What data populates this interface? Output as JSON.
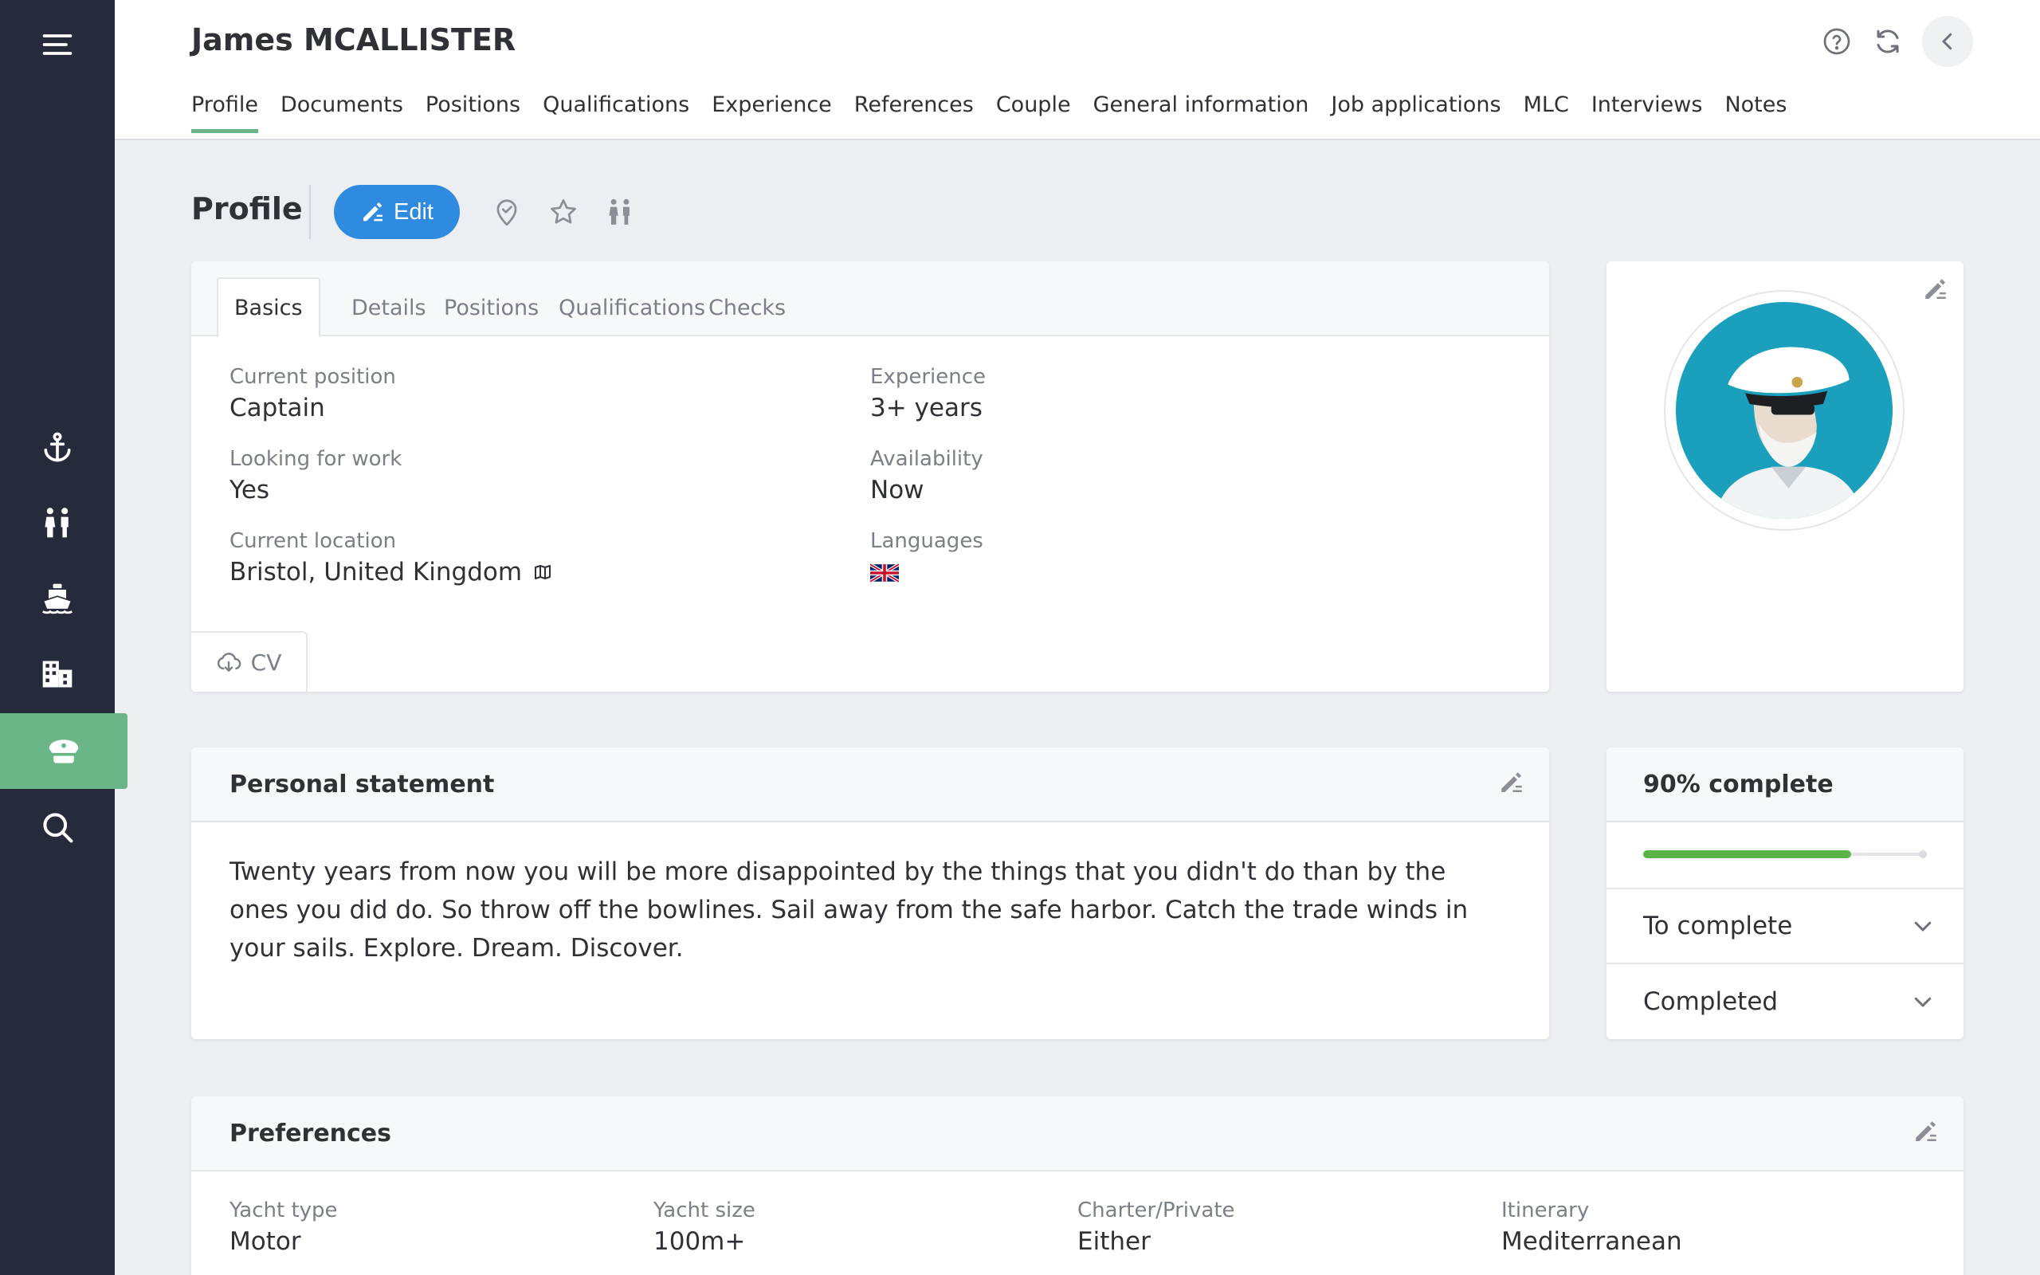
{
  "header": {
    "candidate_name": "James MCALLISTER",
    "tabs": [
      "Profile",
      "Documents",
      "Positions",
      "Qualifications",
      "Experience",
      "References",
      "Couple",
      "General information",
      "Job applications",
      "MLC",
      "Interviews",
      "Notes"
    ],
    "active_tab": "Profile"
  },
  "sidebar": {
    "items": [
      "menu-icon",
      "anchor-icon",
      "couple-icon",
      "ship-icon",
      "building-icon",
      "captain-hat-icon",
      "search-icon"
    ],
    "active": "captain-hat-icon"
  },
  "section": {
    "title": "Profile",
    "edit_label": "Edit"
  },
  "basics": {
    "tabs": [
      "Basics",
      "Details",
      "Positions",
      "Qualifications",
      "Checks"
    ],
    "active_tab": "Basics",
    "current_position_label": "Current position",
    "current_position": "Captain",
    "experience_label": "Experience",
    "experience": "3+ years",
    "looking_label": "Looking for work",
    "looking": "Yes",
    "availability_label": "Availability",
    "availability": "Now",
    "location_label": "Current location",
    "location": "Bristol, United Kingdom",
    "languages_label": "Languages",
    "languages": [
      "uk-flag-icon"
    ],
    "cv_label": "CV"
  },
  "statement": {
    "title": "Personal statement",
    "text": "Twenty years from now you will be more disappointed by the things that you didn't do than by the ones you did do. So throw off the bowlines. Sail away from the safe harbor. Catch the trade winds in your sails. Explore. Dream. Discover."
  },
  "completion": {
    "title": "90% complete",
    "percent": 90,
    "to_complete_label": "To complete",
    "completed_label": "Completed"
  },
  "preferences": {
    "title": "Preferences",
    "yacht_type_label": "Yacht type",
    "yacht_type": "Motor",
    "yacht_size_label": "Yacht size",
    "yacht_size": "100m+",
    "charter_label": "Charter/Private",
    "charter": "Either",
    "itinerary_label": "Itinerary",
    "itinerary": "Mediterranean"
  },
  "colors": {
    "sidebar": "#262b3b",
    "accent_green": "#6bb687",
    "edit_blue": "#2e8be0",
    "progress_green": "#5ab346"
  }
}
